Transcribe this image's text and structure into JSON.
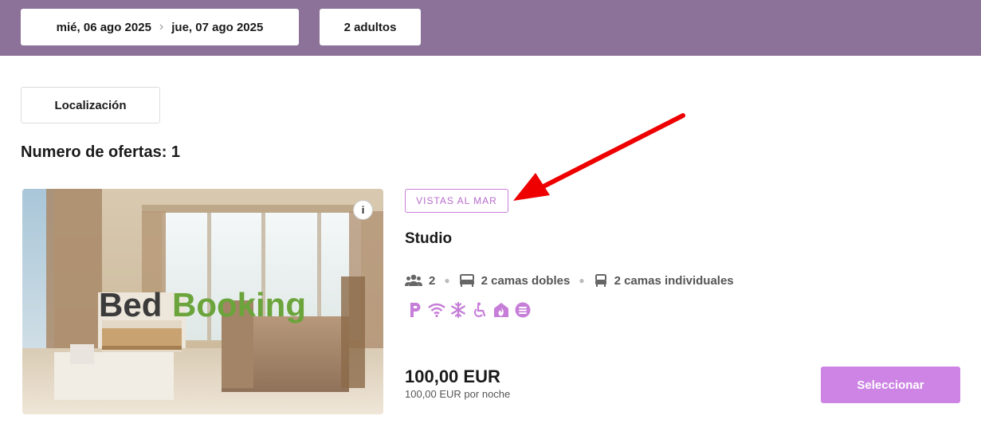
{
  "search": {
    "checkin": "mié, 06 ago 2025",
    "checkout": "jue, 07 ago 2025",
    "guests": "2 adultos"
  },
  "filters": {
    "location_label": "Localización"
  },
  "results": {
    "count_label": "Numero de ofertas: 1"
  },
  "offer": {
    "photo_logo_left": "Bed",
    "photo_logo_right": "Booking",
    "info_label": "i",
    "tag": "VISTAS AL MAR",
    "room_name": "Studio",
    "capacity": "2",
    "double_beds": "2 camas dobles",
    "single_beds": "2 camas individuales",
    "amenities": [
      "parking-icon",
      "wifi-icon",
      "air-conditioning-icon",
      "accessible-icon",
      "fireplace-icon",
      "spa-icon"
    ],
    "price": "100,00 EUR",
    "per_night": "100,00 EUR por noche",
    "select_label": "Seleccionar"
  },
  "colors": {
    "topbar": "#8c7299",
    "accent": "#cd84e4",
    "tag": "#b66bcb",
    "annotation_arrow": "#ee0000"
  }
}
